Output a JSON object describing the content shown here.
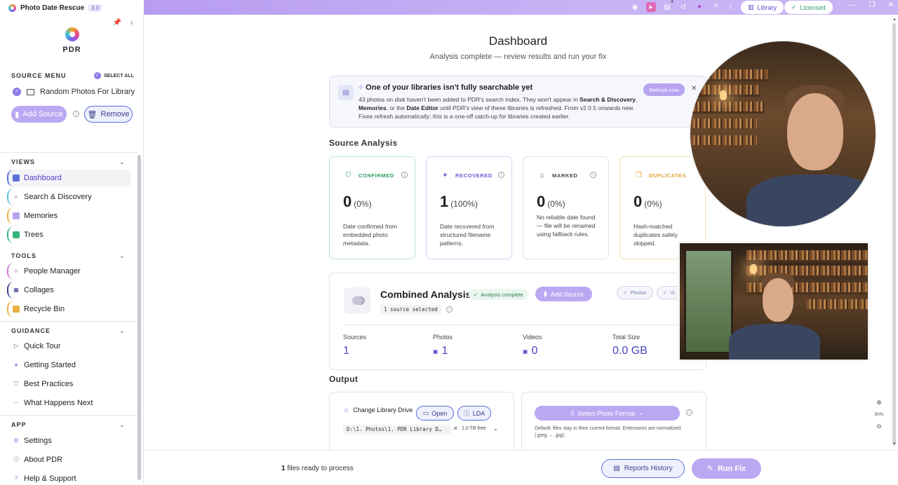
{
  "titlebar": {
    "app_name": "Photo Date Rescue",
    "version": "3.0",
    "badge_count": "4",
    "library_label": "Library",
    "licensed_label": "Licensed"
  },
  "sidebar": {
    "logo_text": "PDR",
    "source_menu_label": "SOURCE MENU",
    "select_all_label": "SELECT ALL",
    "source_name": "Random Photos For Library",
    "add_source_label": "Add Source",
    "remove_label": "Remove",
    "views_label": "VIEWS",
    "views": [
      "Dashboard",
      "Search & Discovery",
      "Memories",
      "Trees"
    ],
    "tools_label": "TOOLS",
    "tools": [
      "People Manager",
      "Collages",
      "Recycle Bin"
    ],
    "guidance_label": "GUIDANCE",
    "guidance": [
      "Quick Tour",
      "Getting Started",
      "Best Practices",
      "What Happens Next"
    ],
    "app_label": "APP",
    "app": [
      "Settings",
      "About PDR",
      "Help & Support"
    ]
  },
  "header": {
    "title": "Dashboard",
    "subtitle": "Analysis complete — review results and run your fix"
  },
  "banner": {
    "title": "One of your libraries isn't fully searchable yet",
    "text_1": "43 photos on disk haven't been added to PDR's search index. They won't appear in ",
    "bold_1": "Search & Discovery",
    "text_2": ", ",
    "bold_2": "Memories",
    "text_3": ", or the ",
    "bold_3": "Date Editor",
    "text_4": " until PDR's view of these libraries is refreshed. From v2.0.5 onwards new Fixes refresh automatically; this is a one-off catch-up for libraries created earlier.",
    "refresh_label": "Refresh now"
  },
  "source_analysis": {
    "heading": "Source Analysis",
    "cards": [
      {
        "label": "CONFIRMED",
        "value": "0",
        "pct": "(0%)",
        "desc": "Date confirmed from embedded photo metadata.",
        "color": "#2b9c62"
      },
      {
        "label": "RECOVERED",
        "value": "1",
        "pct": "(100%)",
        "desc": "Date recovered from structured filename patterns.",
        "color": "#6c58d6"
      },
      {
        "label": "MARKED",
        "value": "0",
        "pct": "(0%)",
        "desc": "No reliable date found — file will be renamed using fallback rules.",
        "color": "#444444"
      },
      {
        "label": "DUPLICATES",
        "value": "0",
        "pct": "(0%)",
        "desc": "Hash-matched duplicates safely skipped.",
        "color": "#e0a030"
      }
    ]
  },
  "combined": {
    "title": "Combined Analysis",
    "status": "Analysis complete",
    "add_source_label": "Add Source",
    "chip_photos": "Photos",
    "chip_videos": "Vi",
    "sources_selected": "1 source selected",
    "stats": [
      {
        "label": "Sources",
        "value": "1"
      },
      {
        "label": "Photos",
        "value": "1"
      },
      {
        "label": "Videos",
        "value": "0"
      },
      {
        "label": "Total Size",
        "value": "0.0 GB"
      }
    ]
  },
  "output": {
    "heading": "Output",
    "change_drive_label": "Change Library Drive",
    "open_label": "Open",
    "lda_label": "LDA",
    "path": "D:\\1. Photos\\1. PDR Library D…",
    "free_space": "1.0 TB free",
    "format_label": "Select Photo Format",
    "format_desc": "Default: files stay in their current format. Extensions are normalized (.jpeg → .jpg)."
  },
  "footer": {
    "ready_count": "1",
    "ready_text": " files ready to process",
    "reports_label": "Reports History",
    "run_label": "Run Fix"
  },
  "zoom": {
    "level": "90%"
  },
  "colors": {
    "accent": "#bba8f2",
    "accent_dark": "#4c3cc9",
    "titlebar": "#c3acf4",
    "success": "#2b9c62"
  },
  "icons": [
    "search-icon",
    "gear-icon",
    "folder-icon",
    "trash-icon",
    "shield-icon",
    "sparkle-icon",
    "tag-icon",
    "copy-icon"
  ]
}
